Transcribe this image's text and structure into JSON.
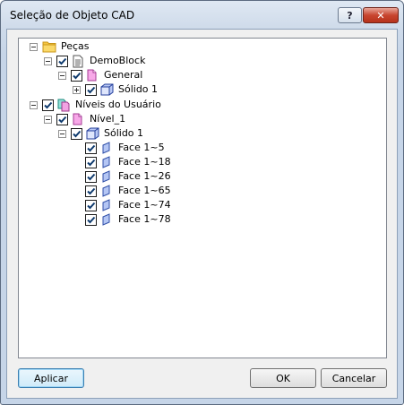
{
  "window": {
    "title": "Seleção de Objeto CAD"
  },
  "titlebar_buttons": {
    "help": "?",
    "close": "✕"
  },
  "tree": {
    "nodes": [
      {
        "label": "Peças",
        "icon": "folder-icon",
        "expander": "collapse",
        "checkbox": false
      },
      {
        "label": "DemoBlock",
        "icon": "document-icon",
        "expander": "collapse",
        "checkbox": true
      },
      {
        "label": "General",
        "icon": "pink-page-icon",
        "expander": "collapse",
        "checkbox": true
      },
      {
        "label": "Sólido 1",
        "icon": "solid-cube-icon",
        "expander": "expand",
        "checkbox": true
      },
      {
        "label": "Níveis do Usuário",
        "icon": "layers-icon",
        "expander": "collapse",
        "checkbox": true
      },
      {
        "label": "Nível_1",
        "icon": "pink-page-icon",
        "expander": "collapse",
        "checkbox": true
      },
      {
        "label": "Sólido 1",
        "icon": "solid-cube-icon",
        "expander": "collapse",
        "checkbox": true
      },
      {
        "label": "Face 1~5",
        "icon": "face-icon",
        "expander": "none",
        "checkbox": true
      },
      {
        "label": "Face 1~18",
        "icon": "face-icon",
        "expander": "none",
        "checkbox": true
      },
      {
        "label": "Face 1~26",
        "icon": "face-icon",
        "expander": "none",
        "checkbox": true
      },
      {
        "label": "Face 1~65",
        "icon": "face-icon",
        "expander": "none",
        "checkbox": true
      },
      {
        "label": "Face 1~74",
        "icon": "face-icon",
        "expander": "none",
        "checkbox": true
      },
      {
        "label": "Face 1~78",
        "icon": "face-icon",
        "expander": "none",
        "checkbox": true
      }
    ]
  },
  "buttons": {
    "apply": "Aplicar",
    "ok": "OK",
    "cancel": "Cancelar"
  }
}
